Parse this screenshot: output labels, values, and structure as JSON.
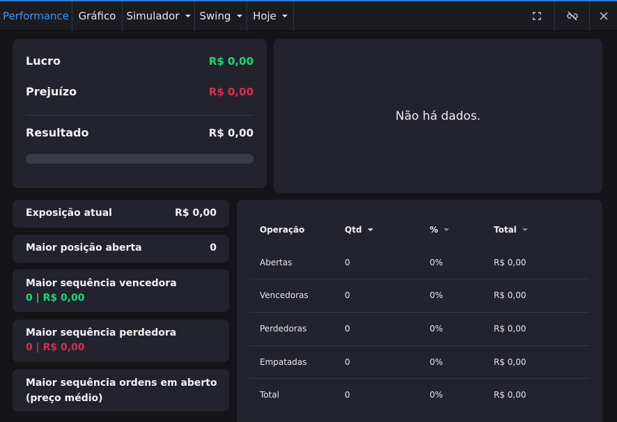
{
  "tabs": [
    {
      "label": "Performance",
      "active": true,
      "dropdown": false
    },
    {
      "label": "Gráfico",
      "active": false,
      "dropdown": false
    },
    {
      "label": "Simulador",
      "active": false,
      "dropdown": true
    },
    {
      "label": "Swing",
      "active": false,
      "dropdown": true
    },
    {
      "label": "Hoje",
      "active": false,
      "dropdown": true
    }
  ],
  "window_icons": [
    "expand-icon",
    "unlink-icon",
    "close-icon"
  ],
  "summary": {
    "lucro_label": "Lucro",
    "lucro_value": "R$ 0,00",
    "prejuizo_label": "Prejuízo",
    "prejuizo_value": "R$ 0,00",
    "resultado_label": "Resultado",
    "resultado_value": "R$ 0,00",
    "progress": 0
  },
  "chart_panel": {
    "empty_message": "Não há dados."
  },
  "stats": {
    "exposicao_label": "Exposição atual",
    "exposicao_value": "R$ 0,00",
    "maior_posicao_label": "Maior posição aberta",
    "maior_posicao_value": "0",
    "seq_vencedora_label": "Maior sequência vencedora",
    "seq_vencedora_value": "0 | R$ 0,00",
    "seq_perdedora_label": "Maior sequência perdedora",
    "seq_perdedora_value": "0 | R$ 0,00",
    "ordens_aberto_label_line1": "Maior sequência ordens em aberto",
    "ordens_aberto_label_line2": "(preço médio)"
  },
  "table": {
    "columns": [
      "Operação",
      "Qtd",
      "%",
      "Total"
    ],
    "rows": [
      {
        "operacao": "Abertas",
        "qtd": "0",
        "pct": "0%",
        "total": "R$ 0,00"
      },
      {
        "operacao": "Vencedoras",
        "qtd": "0",
        "pct": "0%",
        "total": "R$ 0,00"
      },
      {
        "operacao": "Perdedoras",
        "qtd": "0",
        "pct": "0%",
        "total": "R$ 0,00"
      },
      {
        "operacao": "Empatadas",
        "qtd": "0",
        "pct": "0%",
        "total": "R$ 0,00"
      },
      {
        "operacao": "Total",
        "qtd": "0",
        "pct": "0%",
        "total": "R$ 0,00"
      }
    ]
  },
  "colors": {
    "accent": "#2f7ed8",
    "profit": "#1fd777",
    "loss": "#d82e4f"
  }
}
